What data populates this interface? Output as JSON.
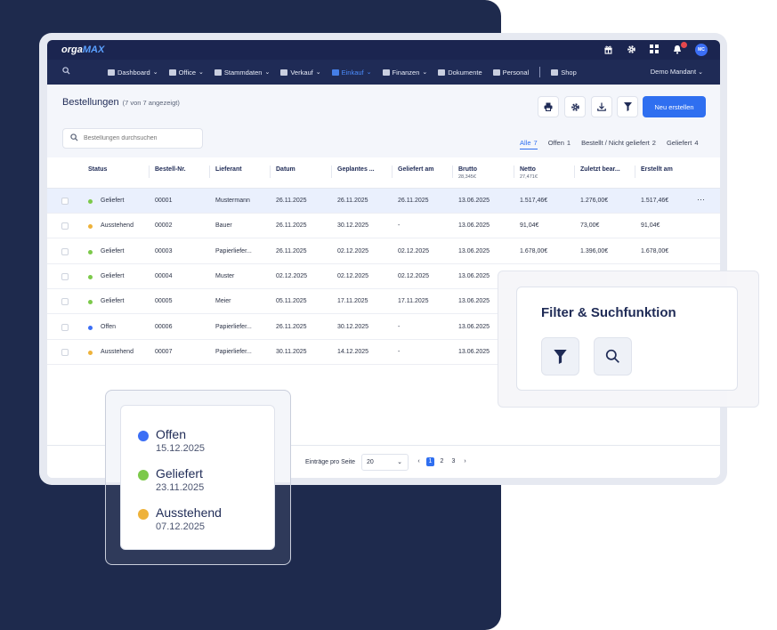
{
  "app": {
    "logo_prefix": "orga",
    "logo_suffix": "MAX",
    "avatar_initials": "MC",
    "mandant": "Demo Mandant"
  },
  "nav": {
    "items": [
      {
        "label": "Dashboard"
      },
      {
        "label": "Office"
      },
      {
        "label": "Stammdaten"
      },
      {
        "label": "Verkauf"
      },
      {
        "label": "Einkauf"
      },
      {
        "label": "Finanzen"
      },
      {
        "label": "Dokumente"
      },
      {
        "label": "Personal"
      },
      {
        "label": "Shop"
      }
    ],
    "active": "Einkauf"
  },
  "page": {
    "title": "Bestellungen",
    "count_text": "(7 von 7 angezeigt)",
    "new_button": "Neu erstellen",
    "search_placeholder": "Bestellungen durchsuchen"
  },
  "tabs": [
    {
      "label": "Alle",
      "count": "7"
    },
    {
      "label": "Offen",
      "count": "1"
    },
    {
      "label": "Bestellt / Nicht geliefert",
      "count": "2"
    },
    {
      "label": "Geliefert",
      "count": "4"
    }
  ],
  "table": {
    "headers": {
      "status": "Status",
      "nr": "Bestell-Nr.",
      "lieferant": "Lieferant",
      "datum": "Datum",
      "geplant": "Geplantes ...",
      "geliefert_am": "Geliefert am",
      "brutto": "Brutto",
      "brutto_sum": "28,345€",
      "netto": "Netto",
      "netto_sum": "27,471€",
      "zuletzt": "Zuletzt bear...",
      "erstellt": "Erstellt am"
    },
    "rows": [
      {
        "status": "Geliefert",
        "nr": "00001",
        "lieferant": "Mustermann",
        "datum": "26.11.2025",
        "geplant": "26.11.2025",
        "geliefert_am": "26.11.2025",
        "brutto": "13.06.2025",
        "netto": "1.517,46€",
        "zuletzt": "1.276,00€",
        "erstellt": "1.517,46€"
      },
      {
        "status": "Ausstehend",
        "nr": "00002",
        "lieferant": "Bauer",
        "datum": "26.11.2025",
        "geplant": "30.12.2025",
        "geliefert_am": "-",
        "brutto": "13.06.2025",
        "netto": "91,04€",
        "zuletzt": "73,00€",
        "erstellt": "91,04€"
      },
      {
        "status": "Geliefert",
        "nr": "00003",
        "lieferant": "Papierliefer...",
        "datum": "26.11.2025",
        "geplant": "02.12.2025",
        "geliefert_am": "02.12.2025",
        "brutto": "13.06.2025",
        "netto": "1.678,00€",
        "zuletzt": "1.396,00€",
        "erstellt": "1.678,00€"
      },
      {
        "status": "Geliefert",
        "nr": "00004",
        "lieferant": "Muster",
        "datum": "02.12.2025",
        "geplant": "02.12.2025",
        "geliefert_am": "02.12.2025",
        "brutto": "13.06.2025",
        "netto": "",
        "zuletzt": "",
        "erstellt": ""
      },
      {
        "status": "Geliefert",
        "nr": "00005",
        "lieferant": "Meier",
        "datum": "05.11.2025",
        "geplant": "17.11.2025",
        "geliefert_am": "17.11.2025",
        "brutto": "13.06.2025",
        "netto": "",
        "zuletzt": "",
        "erstellt": ""
      },
      {
        "status": "Offen",
        "nr": "00006",
        "lieferant": "Papierliefer...",
        "datum": "26.11.2025",
        "geplant": "30.12.2025",
        "geliefert_am": "-",
        "brutto": "13.06.2025",
        "netto": "",
        "zuletzt": "",
        "erstellt": ""
      },
      {
        "status": "Ausstehend",
        "nr": "00007",
        "lieferant": "Papierliefer...",
        "datum": "30.11.2025",
        "geplant": "14.12.2025",
        "geliefert_am": "-",
        "brutto": "13.06.2025",
        "netto": "",
        "zuletzt": "",
        "erstellt": ""
      }
    ],
    "row_more": "···"
  },
  "footer": {
    "per_page_label": "Einträge pro Seite",
    "per_page_value": "20",
    "pages": [
      "1",
      "2",
      "3"
    ],
    "current_page": "1"
  },
  "filter_card": {
    "title": "Filter & Suchfunktion"
  },
  "legend": [
    {
      "label": "Offen",
      "date": "15.12.2025",
      "color": "#3b6ef5"
    },
    {
      "label": "Geliefert",
      "date": "23.11.2025",
      "color": "#7cc94a"
    },
    {
      "label": "Ausstehend",
      "date": "07.12.2025",
      "color": "#eeb23a"
    }
  ],
  "status_colors": {
    "Geliefert": "#7cc94a",
    "Ausstehend": "#eeb23a",
    "Offen": "#3b6ef5"
  }
}
